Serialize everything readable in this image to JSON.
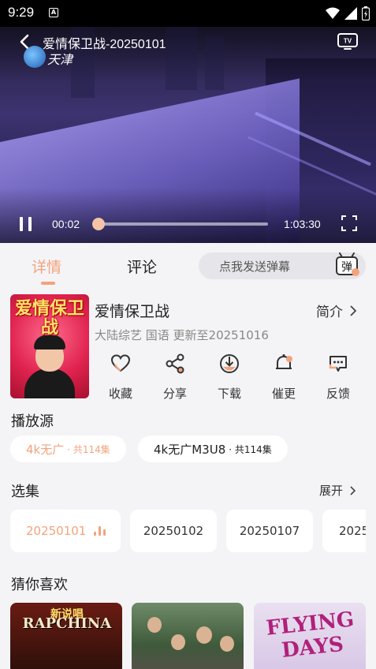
{
  "status_bar": {
    "time": "9:29",
    "notification_icon": "A"
  },
  "player": {
    "title": "爱情保卫战-20250101",
    "channel_logo_text": "天津",
    "current_time": "00:02",
    "total_time": "1:03:30",
    "progress_fraction": 0.002
  },
  "tabs": [
    {
      "label": "详情",
      "active": true
    },
    {
      "label": "评论",
      "active": false
    }
  ],
  "danmu": {
    "placeholder": "点我发送弹幕",
    "icon_label": "弹"
  },
  "show": {
    "poster_text": "爱情保卫战",
    "title": "爱情保卫战",
    "meta": "大陆综艺 国语 更新至20251016",
    "intro_label": "简介"
  },
  "actions": [
    {
      "label": "收藏",
      "icon": "heart-icon"
    },
    {
      "label": "分享",
      "icon": "share-icon"
    },
    {
      "label": "下载",
      "icon": "download-icon"
    },
    {
      "label": "催更",
      "icon": "bell-icon"
    },
    {
      "label": "反馈",
      "icon": "feedback-icon"
    }
  ],
  "sources": {
    "title": "播放源",
    "items": [
      {
        "name": "4k无广",
        "count": "· 共114集",
        "active": true
      },
      {
        "name": "4k无广M3U8",
        "count": "· 共114集",
        "active": false
      }
    ]
  },
  "episodes": {
    "title": "选集",
    "expand_label": "展开",
    "items": [
      "20250101",
      "20250102",
      "20250107",
      "2025"
    ]
  },
  "recommend": {
    "title": "猜你喜欢",
    "items": [
      {
        "text": "RAPCHINA",
        "subtext": "新说唱"
      },
      {
        "text": "",
        "subtext": ""
      },
      {
        "text": "FLYING DAYS",
        "subtext": ""
      }
    ]
  },
  "colors": {
    "accent": "#f3a37c",
    "background": "#f4f4f6"
  }
}
